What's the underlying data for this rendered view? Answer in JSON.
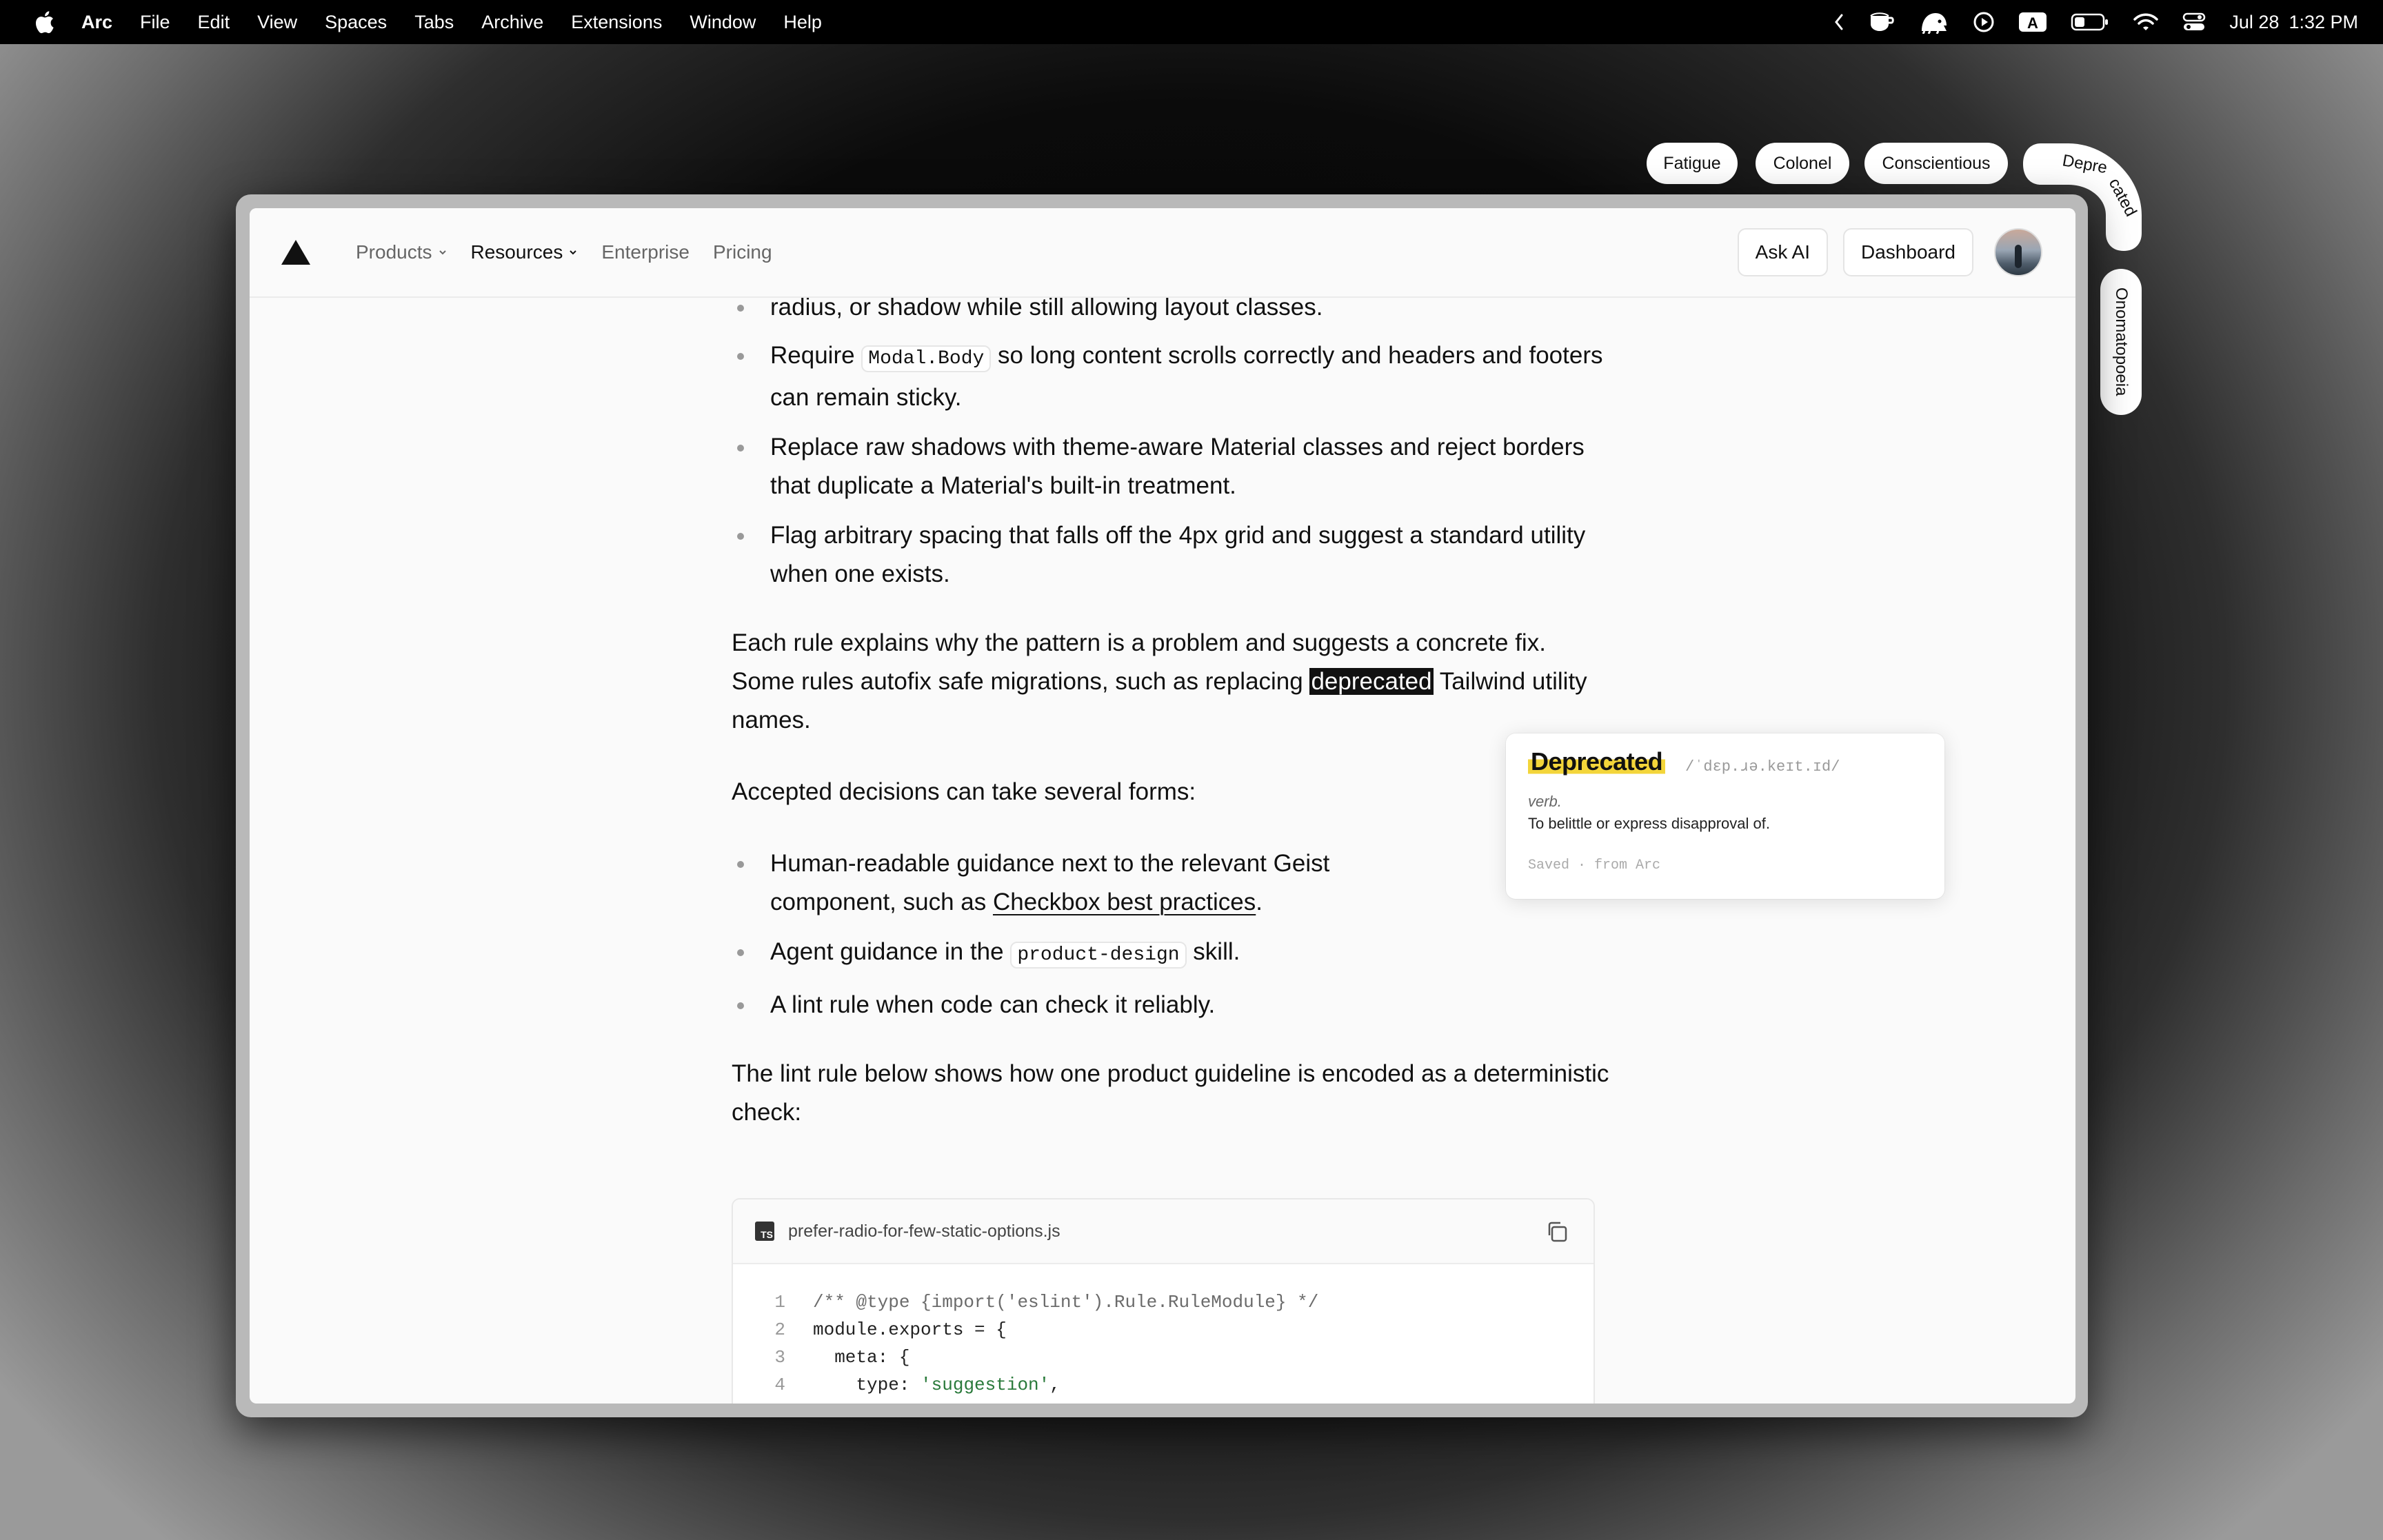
{
  "menubar": {
    "app_name": "Arc",
    "items": [
      "File",
      "Edit",
      "View",
      "Spaces",
      "Tabs",
      "Archive",
      "Extensions",
      "Window",
      "Help"
    ],
    "input_badge": "A",
    "date": "Jul 28",
    "time": "1:32 PM"
  },
  "word_chips": [
    "Fatigue",
    "Colonel",
    "Conscientious",
    "Deprecated",
    "Onomatopoeia"
  ],
  "nav": {
    "links": [
      "Products",
      "Resources",
      "Enterprise",
      "Pricing"
    ],
    "ask_ai": "Ask AI",
    "dashboard": "Dashboard"
  },
  "article": {
    "line_partial": "radius, or shadow while still allowing layout classes.",
    "bullet1_pre": "Require ",
    "bullet1_code": "Modal.Body",
    "bullet1_post": " so long content scrolls correctly and headers and footers can remain sticky.",
    "bullet2": "Replace raw shadows with theme-aware Material classes and reject borders that duplicate a Material's built-in treatment.",
    "bullet3": "Flag arbitrary spacing that falls off the 4px grid and suggest a standard utility when one exists.",
    "para1_pre": "Each rule explains why the pattern is a problem and suggests a concrete fix. Some rules autofix safe migrations, such as replacing ",
    "para1_highlight": "deprecated",
    "para1_post": " Tailwind utility names.",
    "para2": "Accepted decisions can take several forms:",
    "bullet4_pre": "Human-readable guidance next to the relevant Geist component, such as ",
    "bullet4_link": "Checkbox best practices",
    "bullet4_post": ".",
    "bullet5_pre": "Agent guidance in the ",
    "bullet5_code": "product-design",
    "bullet5_post": " skill.",
    "bullet6": "A lint rule when code can check it reliably.",
    "para3": "The lint rule below shows how one product guideline is encoded as a deterministic check:"
  },
  "codeblock": {
    "lang_badge": "TS",
    "filename": "prefer-radio-for-few-static-options.js",
    "line_numbers": [
      "1",
      "2",
      "3",
      "4"
    ],
    "line1": "/** @type {import('eslint').Rule.RuleModule} */",
    "line2": "module.exports = {",
    "line3": "  meta: {",
    "line4_key": "    type: ",
    "line4_str": "'suggestion'",
    "line4_end": ","
  },
  "popover": {
    "word": "Deprecated",
    "phonetic": "/ˈdɛp.ɹə.keɪt.ɪd/",
    "part_of_speech": "verb.",
    "definition": "To belittle or express disapproval of.",
    "meta": "Saved · from Arc"
  }
}
